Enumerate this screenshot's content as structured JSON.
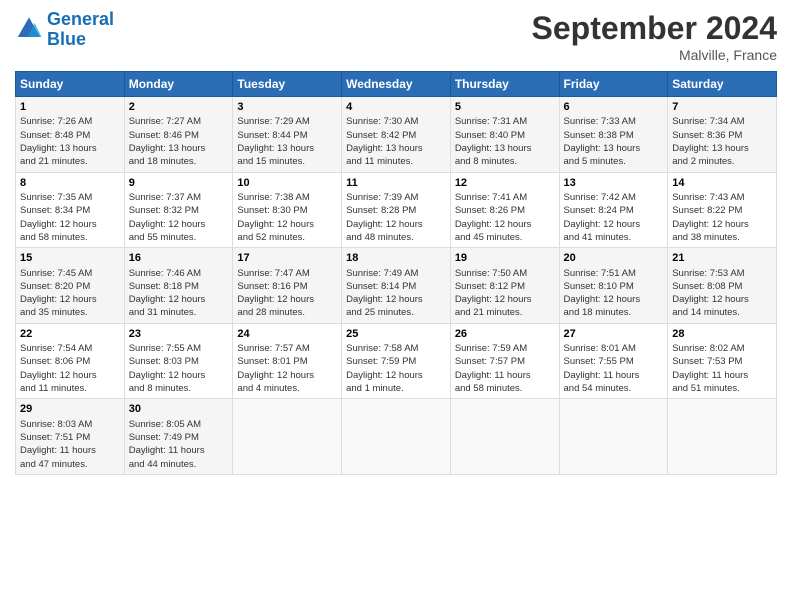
{
  "header": {
    "logo_line1": "General",
    "logo_line2": "Blue",
    "month": "September 2024",
    "location": "Malville, France"
  },
  "columns": [
    "Sunday",
    "Monday",
    "Tuesday",
    "Wednesday",
    "Thursday",
    "Friday",
    "Saturday"
  ],
  "weeks": [
    [
      {
        "day": "1",
        "info": "Sunrise: 7:26 AM\nSunset: 8:48 PM\nDaylight: 13 hours\nand 21 minutes."
      },
      {
        "day": "2",
        "info": "Sunrise: 7:27 AM\nSunset: 8:46 PM\nDaylight: 13 hours\nand 18 minutes."
      },
      {
        "day": "3",
        "info": "Sunrise: 7:29 AM\nSunset: 8:44 PM\nDaylight: 13 hours\nand 15 minutes."
      },
      {
        "day": "4",
        "info": "Sunrise: 7:30 AM\nSunset: 8:42 PM\nDaylight: 13 hours\nand 11 minutes."
      },
      {
        "day": "5",
        "info": "Sunrise: 7:31 AM\nSunset: 8:40 PM\nDaylight: 13 hours\nand 8 minutes."
      },
      {
        "day": "6",
        "info": "Sunrise: 7:33 AM\nSunset: 8:38 PM\nDaylight: 13 hours\nand 5 minutes."
      },
      {
        "day": "7",
        "info": "Sunrise: 7:34 AM\nSunset: 8:36 PM\nDaylight: 13 hours\nand 2 minutes."
      }
    ],
    [
      {
        "day": "8",
        "info": "Sunrise: 7:35 AM\nSunset: 8:34 PM\nDaylight: 12 hours\nand 58 minutes."
      },
      {
        "day": "9",
        "info": "Sunrise: 7:37 AM\nSunset: 8:32 PM\nDaylight: 12 hours\nand 55 minutes."
      },
      {
        "day": "10",
        "info": "Sunrise: 7:38 AM\nSunset: 8:30 PM\nDaylight: 12 hours\nand 52 minutes."
      },
      {
        "day": "11",
        "info": "Sunrise: 7:39 AM\nSunset: 8:28 PM\nDaylight: 12 hours\nand 48 minutes."
      },
      {
        "day": "12",
        "info": "Sunrise: 7:41 AM\nSunset: 8:26 PM\nDaylight: 12 hours\nand 45 minutes."
      },
      {
        "day": "13",
        "info": "Sunrise: 7:42 AM\nSunset: 8:24 PM\nDaylight: 12 hours\nand 41 minutes."
      },
      {
        "day": "14",
        "info": "Sunrise: 7:43 AM\nSunset: 8:22 PM\nDaylight: 12 hours\nand 38 minutes."
      }
    ],
    [
      {
        "day": "15",
        "info": "Sunrise: 7:45 AM\nSunset: 8:20 PM\nDaylight: 12 hours\nand 35 minutes."
      },
      {
        "day": "16",
        "info": "Sunrise: 7:46 AM\nSunset: 8:18 PM\nDaylight: 12 hours\nand 31 minutes."
      },
      {
        "day": "17",
        "info": "Sunrise: 7:47 AM\nSunset: 8:16 PM\nDaylight: 12 hours\nand 28 minutes."
      },
      {
        "day": "18",
        "info": "Sunrise: 7:49 AM\nSunset: 8:14 PM\nDaylight: 12 hours\nand 25 minutes."
      },
      {
        "day": "19",
        "info": "Sunrise: 7:50 AM\nSunset: 8:12 PM\nDaylight: 12 hours\nand 21 minutes."
      },
      {
        "day": "20",
        "info": "Sunrise: 7:51 AM\nSunset: 8:10 PM\nDaylight: 12 hours\nand 18 minutes."
      },
      {
        "day": "21",
        "info": "Sunrise: 7:53 AM\nSunset: 8:08 PM\nDaylight: 12 hours\nand 14 minutes."
      }
    ],
    [
      {
        "day": "22",
        "info": "Sunrise: 7:54 AM\nSunset: 8:06 PM\nDaylight: 12 hours\nand 11 minutes."
      },
      {
        "day": "23",
        "info": "Sunrise: 7:55 AM\nSunset: 8:03 PM\nDaylight: 12 hours\nand 8 minutes."
      },
      {
        "day": "24",
        "info": "Sunrise: 7:57 AM\nSunset: 8:01 PM\nDaylight: 12 hours\nand 4 minutes."
      },
      {
        "day": "25",
        "info": "Sunrise: 7:58 AM\nSunset: 7:59 PM\nDaylight: 12 hours\nand 1 minute."
      },
      {
        "day": "26",
        "info": "Sunrise: 7:59 AM\nSunset: 7:57 PM\nDaylight: 11 hours\nand 58 minutes."
      },
      {
        "day": "27",
        "info": "Sunrise: 8:01 AM\nSunset: 7:55 PM\nDaylight: 11 hours\nand 54 minutes."
      },
      {
        "day": "28",
        "info": "Sunrise: 8:02 AM\nSunset: 7:53 PM\nDaylight: 11 hours\nand 51 minutes."
      }
    ],
    [
      {
        "day": "29",
        "info": "Sunrise: 8:03 AM\nSunset: 7:51 PM\nDaylight: 11 hours\nand 47 minutes."
      },
      {
        "day": "30",
        "info": "Sunrise: 8:05 AM\nSunset: 7:49 PM\nDaylight: 11 hours\nand 44 minutes."
      },
      {
        "day": "",
        "info": ""
      },
      {
        "day": "",
        "info": ""
      },
      {
        "day": "",
        "info": ""
      },
      {
        "day": "",
        "info": ""
      },
      {
        "day": "",
        "info": ""
      }
    ]
  ]
}
